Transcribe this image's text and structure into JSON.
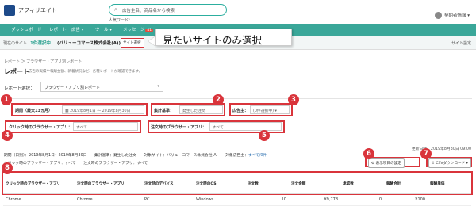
{
  "header": {
    "logo_icon": "vc-logo-icon",
    "app_name": "アフィリエイト",
    "search_placeholder": "広告主名、商品名から検索",
    "user_label": "人気ワード：",
    "account": "契約者情報"
  },
  "nav": {
    "items": [
      "ダッシュボード",
      "レポート",
      "広告",
      "ツール",
      "メッセージ"
    ],
    "message_badge": "41"
  },
  "subbar": {
    "label": "現在のサイト",
    "count": "1件選択中",
    "company": "(バリューコマース株式会社(A))",
    "site_button": "サイト選択",
    "right": "サイト設定"
  },
  "callout": {
    "text": "見たいサイトのみ選択"
  },
  "page": {
    "breadcrumb": "レポート ＞ ブラウザー・アプリ別レポート",
    "title": "レポート",
    "description": "広告の実績や報酬金額、新着状況など、各種レポートが確認できます。",
    "report_select_label": "レポート選択：",
    "report_select_value": "ブラウザー・アプリ別レポート"
  },
  "filters": {
    "period_label": "期間（最大13ヵ月）",
    "period_value": "2019年8月1日 〜 2019年8月30日",
    "basis_label": "集計基準：",
    "basis_value": "発生した注文",
    "advertiser_label": "広告主：",
    "advertiser_value": "(0件選択中)",
    "click_browser_label": "クリック時のブラウザー・アプリ：",
    "click_browser_value": "すべて",
    "order_browser_label": "注文時のブラウザー・アプリ：",
    "order_browser_value": "すべて"
  },
  "markers": [
    "1",
    "2",
    "3",
    "4",
    "5",
    "6",
    "7",
    "8"
  ],
  "summary": {
    "line1": "期間（日別）：2019年8月1日〜2019年8月30日　　集計基準：発生した注文　　対象サイト：バリューコマース株式会社(A)　　対象広告主：",
    "line1_link": "すべて/0件",
    "line2": "クリック時のブラウザー・アプリ：すべて　　注文時のブラウザー・アプリ：すべて",
    "updated": "更新日時：2019年8月30日 09:00",
    "display_settings": "表示項目の設定",
    "csv_download": "CSVダウンロード"
  },
  "table": {
    "headers": [
      "クリック時のブラウザー・アプリ",
      "注文時のブラウザー・アプリ",
      "注文時のデバイス",
      "注文時のOS",
      "注文数",
      "注文金額",
      "承認数",
      "報酬合計",
      "報酬単価"
    ],
    "rows": [
      [
        "Chrome",
        "Chrome",
        "PC",
        "Windows",
        "10",
        "¥9,778",
        "0",
        "¥100",
        ""
      ]
    ]
  }
}
